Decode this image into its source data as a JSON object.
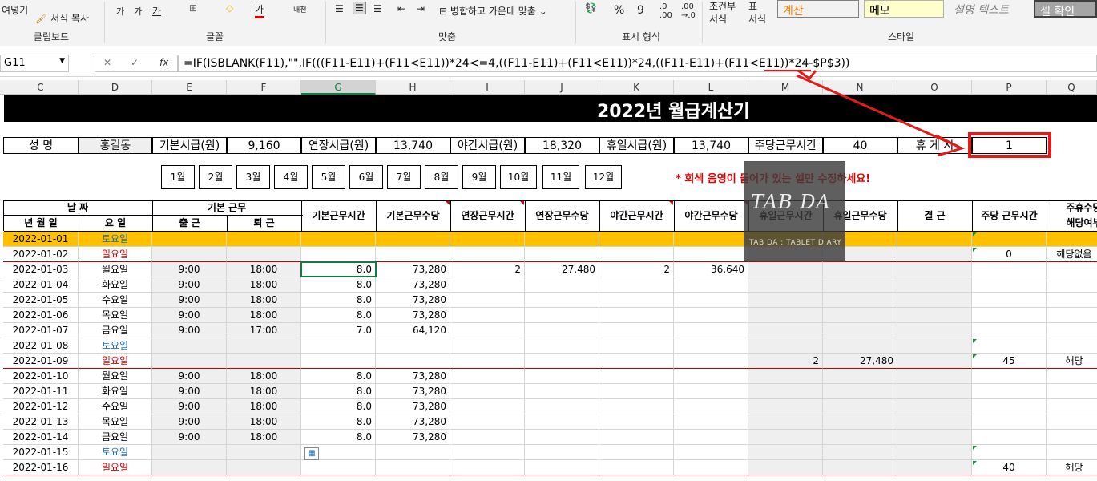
{
  "ribbon": {
    "paste": "여넣기",
    "format_copy": "서식 복사",
    "font_size_up": "가",
    "font_size_down": "가",
    "font_text_color": "가",
    "wrap": "내천",
    "merge_center": "병합하고 가운데 맞춤",
    "percent": "%",
    "comma": "9",
    "cond_format": "조건부\n서식",
    "table_format": "표\n서식",
    "style_calc": "계산",
    "style_memo": "메모",
    "style_desc": "설명 텍스트",
    "style_check": "셀 확인",
    "group_clipboard": "클립보드",
    "group_font": "글꼴",
    "group_align": "맞춤",
    "group_number": "표시 형식",
    "group_style": "스타일"
  },
  "formula_bar": {
    "name_box": "G11",
    "formula": "=IF(ISBLANK(F11),\"\",IF(((F11-E11)+(F11<E11))*24<=4,((F11-E11)+(F11<E11))*24,((F11-E11)+(F11<E11))*24-$P$3))"
  },
  "columns": [
    "C",
    "D",
    "E",
    "F",
    "G",
    "H",
    "I",
    "J",
    "K",
    "L",
    "M",
    "N",
    "O",
    "P",
    "Q"
  ],
  "sheet": {
    "title": "2022년 월급계산기",
    "info": {
      "name_label": "성    명",
      "name_value": "홍길동",
      "base_label": "기본시급(원)",
      "base_value": "9,160",
      "ot_label": "연장시급(원)",
      "ot_value": "13,740",
      "night_label": "야간시급(원)",
      "night_value": "18,320",
      "holiday_label": "휴일시급(원)",
      "holiday_value": "13,740",
      "weekly_label": "주당근무시간",
      "weekly_value": "40",
      "rest_label": "휴 게 시",
      "rest_value": "1"
    },
    "months": [
      "1월",
      "2월",
      "3월",
      "4월",
      "5월",
      "6월",
      "7월",
      "8월",
      "9월",
      "10월",
      "11월",
      "12월"
    ],
    "note": "* 회색 음영이 들어가 있는 셀만 수정하세요!",
    "headers": {
      "date_group": "날 짜",
      "date": "년 월 일",
      "day": "요 일",
      "basic_group": "기본 근무",
      "in": "출 근",
      "out": "퇴 근",
      "basic_hours": "기본근무시간",
      "basic_pay": "기본근무수당",
      "ot_hours": "연장근무시간",
      "ot_pay": "연장근무수당",
      "night_hours": "야간근무시간",
      "night_pay": "야간근무수당",
      "holiday_hours": "휴일근무시간",
      "holiday_pay": "휴일근무수당",
      "absence": "결 근",
      "weekly_hours": "주당 근무시간",
      "weekly_rest": "주휴수당",
      "weekly_rest2": "해당여부"
    },
    "rows": [
      {
        "date": "2022-01-01",
        "day": "토요일",
        "in": "",
        "out": "",
        "bh": "",
        "bp": "",
        "oh": "",
        "op": "",
        "nh": "",
        "np": "",
        "hh": "",
        "hp": "",
        "ab": "",
        "wk": "",
        "q": ""
      },
      {
        "date": "2022-01-02",
        "day": "일요일",
        "in": "",
        "out": "",
        "bh": "",
        "bp": "",
        "oh": "",
        "op": "",
        "nh": "",
        "np": "",
        "hh": "",
        "hp": "",
        "ab": "",
        "wk": "0",
        "q": "해당없음"
      },
      {
        "date": "2022-01-03",
        "day": "월요일",
        "in": "9:00",
        "out": "18:00",
        "bh": "8.0",
        "bp": "73,280",
        "oh": "2",
        "op": "27,480",
        "nh": "2",
        "np": "36,640",
        "hh": "",
        "hp": "",
        "ab": "",
        "wk": "",
        "q": ""
      },
      {
        "date": "2022-01-04",
        "day": "화요일",
        "in": "9:00",
        "out": "18:00",
        "bh": "8.0",
        "bp": "73,280",
        "oh": "",
        "op": "",
        "nh": "",
        "np": "",
        "hh": "",
        "hp": "",
        "ab": "",
        "wk": "",
        "q": ""
      },
      {
        "date": "2022-01-05",
        "day": "수요일",
        "in": "9:00",
        "out": "18:00",
        "bh": "8.0",
        "bp": "73,280",
        "oh": "",
        "op": "",
        "nh": "",
        "np": "",
        "hh": "",
        "hp": "",
        "ab": "",
        "wk": "",
        "q": ""
      },
      {
        "date": "2022-01-06",
        "day": "목요일",
        "in": "9:00",
        "out": "18:00",
        "bh": "8.0",
        "bp": "73,280",
        "oh": "",
        "op": "",
        "nh": "",
        "np": "",
        "hh": "",
        "hp": "",
        "ab": "",
        "wk": "",
        "q": ""
      },
      {
        "date": "2022-01-07",
        "day": "금요일",
        "in": "9:00",
        "out": "17:00",
        "bh": "7.0",
        "bp": "64,120",
        "oh": "",
        "op": "",
        "nh": "",
        "np": "",
        "hh": "",
        "hp": "",
        "ab": "",
        "wk": "",
        "q": ""
      },
      {
        "date": "2022-01-08",
        "day": "토요일",
        "in": "",
        "out": "",
        "bh": "",
        "bp": "",
        "oh": "",
        "op": "",
        "nh": "",
        "np": "",
        "hh": "",
        "hp": "",
        "ab": "",
        "wk": "",
        "q": ""
      },
      {
        "date": "2022-01-09",
        "day": "일요일",
        "in": "",
        "out": "",
        "bh": "",
        "bp": "",
        "oh": "",
        "op": "",
        "nh": "",
        "np": "",
        "hh": "2",
        "hp": "27,480",
        "ab": "",
        "wk": "45",
        "q": "해당"
      },
      {
        "date": "2022-01-10",
        "day": "월요일",
        "in": "9:00",
        "out": "18:00",
        "bh": "8.0",
        "bp": "73,280",
        "oh": "",
        "op": "",
        "nh": "",
        "np": "",
        "hh": "",
        "hp": "",
        "ab": "",
        "wk": "",
        "q": ""
      },
      {
        "date": "2022-01-11",
        "day": "화요일",
        "in": "9:00",
        "out": "18:00",
        "bh": "8.0",
        "bp": "73,280",
        "oh": "",
        "op": "",
        "nh": "",
        "np": "",
        "hh": "",
        "hp": "",
        "ab": "",
        "wk": "",
        "q": ""
      },
      {
        "date": "2022-01-12",
        "day": "수요일",
        "in": "9:00",
        "out": "18:00",
        "bh": "8.0",
        "bp": "73,280",
        "oh": "",
        "op": "",
        "nh": "",
        "np": "",
        "hh": "",
        "hp": "",
        "ab": "",
        "wk": "",
        "q": ""
      },
      {
        "date": "2022-01-13",
        "day": "목요일",
        "in": "9:00",
        "out": "18:00",
        "bh": "8.0",
        "bp": "73,280",
        "oh": "",
        "op": "",
        "nh": "",
        "np": "",
        "hh": "",
        "hp": "",
        "ab": "",
        "wk": "",
        "q": ""
      },
      {
        "date": "2022-01-14",
        "day": "금요일",
        "in": "9:00",
        "out": "18:00",
        "bh": "8.0",
        "bp": "73,280",
        "oh": "",
        "op": "",
        "nh": "",
        "np": "",
        "hh": "",
        "hp": "",
        "ab": "",
        "wk": "",
        "q": ""
      },
      {
        "date": "2022-01-15",
        "day": "토요일",
        "in": "",
        "out": "",
        "bh": "",
        "bp": "",
        "oh": "",
        "op": "",
        "nh": "",
        "np": "",
        "hh": "",
        "hp": "",
        "ab": "",
        "wk": "",
        "q": ""
      },
      {
        "date": "2022-01-16",
        "day": "일요일",
        "in": "",
        "out": "",
        "bh": "",
        "bp": "",
        "oh": "",
        "op": "",
        "nh": "",
        "np": "",
        "hh": "",
        "hp": "",
        "ab": "",
        "wk": "40",
        "q": "해당"
      }
    ]
  },
  "watermark": {
    "title": "TAB DA",
    "subtitle": "TAB DA : TABLET DIARY"
  },
  "colors": {
    "accent_red": "#e41b1b",
    "excel_green": "#107c41",
    "highlight": "#ffc000",
    "gray_cell": "#efefef"
  }
}
